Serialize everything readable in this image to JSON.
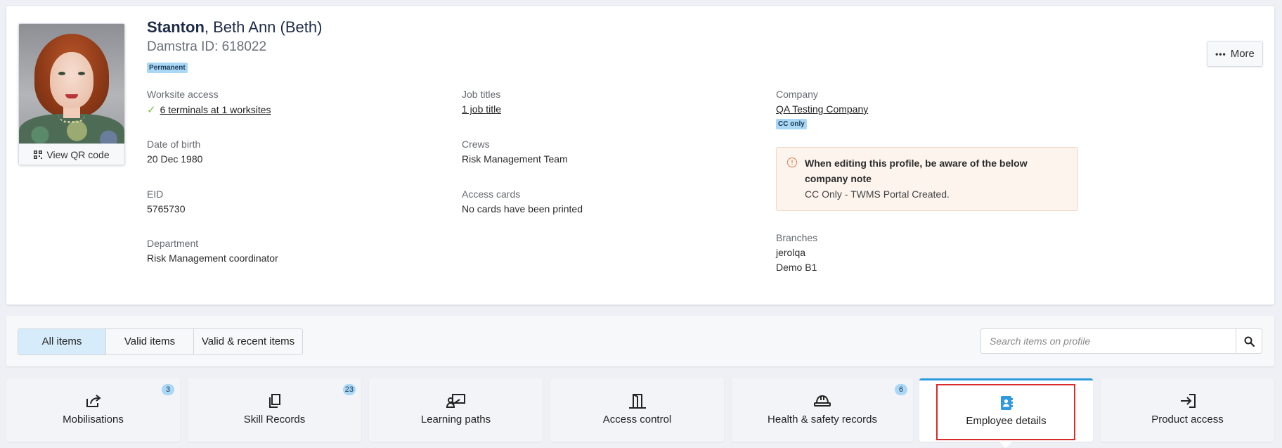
{
  "profile": {
    "surname": "Stanton",
    "given_names": ", Beth Ann (Beth)",
    "damstra_id": "Damstra ID: 618022",
    "employment_badge": "Permanent",
    "qr_label": "View QR code",
    "more_label": "More"
  },
  "fields": {
    "worksite_access": {
      "label": "Worksite access",
      "value": "6 terminals at 1 worksites"
    },
    "date_of_birth": {
      "label": "Date of birth",
      "value": "20 Dec 1980"
    },
    "eid": {
      "label": "EID",
      "value": "5765730"
    },
    "department": {
      "label": "Department",
      "value": "Risk Management coordinator"
    },
    "job_titles": {
      "label": "Job titles",
      "value": "1 job title"
    },
    "crews": {
      "label": "Crews",
      "value": "Risk Management Team"
    },
    "access_cards": {
      "label": "Access cards",
      "value": "No cards have been printed"
    },
    "company": {
      "label": "Company",
      "value": "QA Testing Company",
      "badge": "CC only"
    },
    "branches": {
      "label": "Branches",
      "values": [
        "jerolqa",
        "Demo B1"
      ]
    }
  },
  "company_note": {
    "title": "When editing this profile, be aware of the below company note",
    "body": "CC Only - TWMS Portal Created."
  },
  "filters": {
    "options": [
      "All items",
      "Valid items",
      "Valid & recent items"
    ],
    "selected": "All items",
    "search_placeholder": "Search items on profile"
  },
  "tabs": [
    {
      "label": "Mobilisations",
      "count": "3",
      "icon": "share-icon"
    },
    {
      "label": "Skill Records",
      "count": "23",
      "icon": "copy-icon"
    },
    {
      "label": "Learning paths",
      "count": "",
      "icon": "learning-icon"
    },
    {
      "label": "Access control",
      "count": "",
      "icon": "door-icon"
    },
    {
      "label": "Health & safety records",
      "count": "6",
      "icon": "hardhat-icon"
    },
    {
      "label": "Employee details",
      "count": "",
      "icon": "contact-book-icon",
      "active": true
    },
    {
      "label": "Product access",
      "count": "",
      "icon": "sign-in-icon"
    }
  ],
  "colors": {
    "accent": "#2f9ae0",
    "badge_bg": "#a9d7f5",
    "highlight": "#d92b2b",
    "check": "#7ac142",
    "note_bg": "#fdf4ee"
  }
}
